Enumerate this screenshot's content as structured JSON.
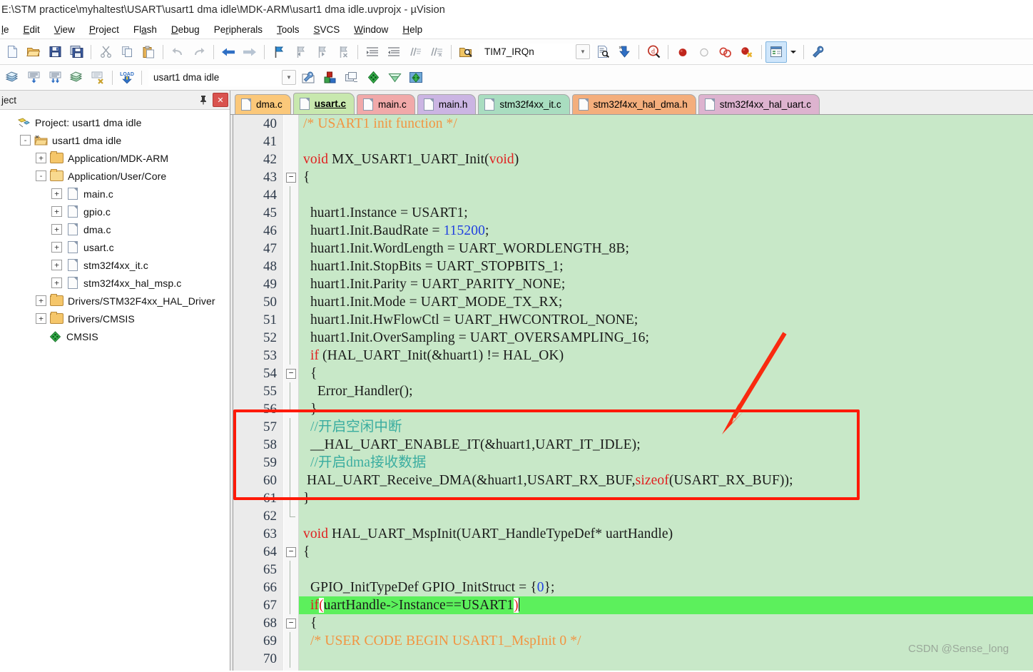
{
  "window": {
    "title": "E:\\STM practice\\myhaltest\\USART\\usart1 dma idle\\MDK-ARM\\usart1 dma idle.uvprojx - µVision"
  },
  "menubar": {
    "items": [
      {
        "label": "File",
        "visible_label": "le"
      },
      {
        "label": "Edit"
      },
      {
        "label": "View"
      },
      {
        "label": "Project"
      },
      {
        "label": "Flash"
      },
      {
        "label": "Debug"
      },
      {
        "label": "Peripherals"
      },
      {
        "label": "Tools"
      },
      {
        "label": "SVCS"
      },
      {
        "label": "Window"
      },
      {
        "label": "Help"
      }
    ]
  },
  "toolbar1": {
    "buttons": [
      {
        "name": "new-file-icon",
        "tip": "New"
      },
      {
        "name": "open-file-icon",
        "tip": "Open"
      },
      {
        "name": "save-icon",
        "tip": "Save"
      },
      {
        "name": "save-all-icon",
        "tip": "Save All"
      },
      {
        "name": "cut-icon",
        "tip": "Cut"
      },
      {
        "name": "copy-icon",
        "tip": "Copy"
      },
      {
        "name": "paste-icon",
        "tip": "Paste"
      },
      {
        "name": "undo-icon",
        "tip": "Undo"
      },
      {
        "name": "redo-icon",
        "tip": "Redo"
      },
      {
        "name": "navigate-back-icon",
        "tip": "Back"
      },
      {
        "name": "navigate-forward-icon",
        "tip": "Forward"
      },
      {
        "name": "bookmark-toggle-icon",
        "tip": "Insert/Remove Bookmark"
      },
      {
        "name": "bookmark-prev-icon",
        "tip": "Previous Bookmark"
      },
      {
        "name": "bookmark-next-icon",
        "tip": "Next Bookmark"
      },
      {
        "name": "bookmark-clear-icon",
        "tip": "Clear All Bookmarks"
      },
      {
        "name": "indent-increase-icon",
        "tip": "Indent"
      },
      {
        "name": "indent-decrease-icon",
        "tip": "Outdent"
      },
      {
        "name": "comment-icon",
        "tip": "Comment"
      },
      {
        "name": "uncomment-icon",
        "tip": "Uncomment"
      }
    ],
    "find_combo": {
      "value": "TIM7_IRQn",
      "placeholder": "Find"
    },
    "right_buttons": [
      {
        "name": "find-in-files-icon",
        "tip": "Find in Files"
      },
      {
        "name": "incremental-find-icon",
        "tip": "Incremental Find"
      },
      {
        "name": "browse-symbol-icon",
        "tip": "Browse Symbol"
      },
      {
        "name": "insert-breakpoint-icon",
        "tip": "Insert/Remove Breakpoint"
      },
      {
        "name": "disable-breakpoint-icon",
        "tip": "Enable/Disable Breakpoint"
      },
      {
        "name": "disable-all-breakpoints-icon",
        "tip": "Disable All Breakpoints"
      },
      {
        "name": "kill-all-breakpoints-icon",
        "tip": "Kill All Breakpoints"
      },
      {
        "name": "project-window-icon",
        "tip": "Project Window"
      },
      {
        "name": "configuration-wizard-icon",
        "tip": "Configure"
      }
    ]
  },
  "toolbar2": {
    "buttons": [
      {
        "name": "translate-icon",
        "tip": "Translate"
      },
      {
        "name": "build-icon",
        "tip": "Build"
      },
      {
        "name": "rebuild-icon",
        "tip": "Rebuild"
      },
      {
        "name": "batch-build-icon",
        "tip": "Batch Build"
      },
      {
        "name": "stop-build-icon",
        "tip": "Stop Build"
      },
      {
        "name": "load-icon",
        "tip": "Download"
      }
    ],
    "target_combo": {
      "value": "usart1 dma idle",
      "placeholder": "Select Target"
    },
    "right_buttons": [
      {
        "name": "target-options-icon",
        "tip": "Options for Target"
      },
      {
        "name": "manage-run-time-icon",
        "tip": "Manage Run-Time Environment"
      },
      {
        "name": "multi-project-icon",
        "tip": "Manage Multi-Project"
      },
      {
        "name": "pack-installer-icon",
        "tip": "Pack Installer"
      },
      {
        "name": "svcs-icon",
        "tip": "Source Control"
      },
      {
        "name": "manage-components-icon",
        "tip": "Manage Components"
      }
    ]
  },
  "project_panel": {
    "title": "ject",
    "pin_icon": "pin-icon",
    "close_icon": "close-icon",
    "tree": [
      {
        "indent": 0,
        "expander": "",
        "icon": "project-icon",
        "label": "Project: usart1 dma idle"
      },
      {
        "indent": 1,
        "expander": "-",
        "icon": "target-folder-icon",
        "label": "usart1 dma idle"
      },
      {
        "indent": 2,
        "expander": "+",
        "icon": "folder-icon",
        "label": "Application/MDK-ARM"
      },
      {
        "indent": 2,
        "expander": "-",
        "icon": "folder-open-icon",
        "label": "Application/User/Core"
      },
      {
        "indent": 3,
        "expander": "+",
        "icon": "file-icon",
        "label": "main.c"
      },
      {
        "indent": 3,
        "expander": "+",
        "icon": "file-icon",
        "label": "gpio.c"
      },
      {
        "indent": 3,
        "expander": "+",
        "icon": "file-icon",
        "label": "dma.c"
      },
      {
        "indent": 3,
        "expander": "+",
        "icon": "file-icon",
        "label": "usart.c"
      },
      {
        "indent": 3,
        "expander": "+",
        "icon": "file-icon",
        "label": "stm32f4xx_it.c"
      },
      {
        "indent": 3,
        "expander": "+",
        "icon": "file-icon",
        "label": "stm32f4xx_hal_msp.c"
      },
      {
        "indent": 2,
        "expander": "+",
        "icon": "folder-icon",
        "label": "Drivers/STM32F4xx_HAL_Driver"
      },
      {
        "indent": 2,
        "expander": "+",
        "icon": "folder-icon",
        "label": "Drivers/CMSIS"
      },
      {
        "indent": 2,
        "expander": "",
        "icon": "cmsis-icon",
        "label": "CMSIS"
      }
    ]
  },
  "editor": {
    "tabs": [
      {
        "label": "dma.c",
        "color": "#fbc87a",
        "active": false
      },
      {
        "label": "usart.c",
        "color": "#c8e8ae",
        "active": true
      },
      {
        "label": "main.c",
        "color": "#f1a9a9",
        "active": false
      },
      {
        "label": "main.h",
        "color": "#cbb5e3",
        "active": false
      },
      {
        "label": "stm32f4xx_it.c",
        "color": "#a9ddc0",
        "active": false
      },
      {
        "label": "stm32f4xx_hal_dma.h",
        "color": "#f4ae7c",
        "active": false
      },
      {
        "label": "stm32f4xx_hal_uart.c",
        "color": "#ddb3cf",
        "active": false
      }
    ],
    "first_line_number": 40,
    "lines": [
      {
        "n": 40,
        "fold": "",
        "tokens": [
          {
            "t": "/* USART1 init function */",
            "c": "cmt"
          }
        ]
      },
      {
        "n": 41,
        "fold": "",
        "tokens": []
      },
      {
        "n": 42,
        "fold": "",
        "tokens": [
          {
            "t": "void",
            "c": "kw"
          },
          {
            "t": " MX_USART1_UART_Init(",
            "c": ""
          },
          {
            "t": "void",
            "c": "kw"
          },
          {
            "t": ")",
            "c": ""
          }
        ]
      },
      {
        "n": 43,
        "fold": "start",
        "tokens": [
          {
            "t": "{",
            "c": ""
          }
        ]
      },
      {
        "n": 44,
        "fold": "bar",
        "tokens": []
      },
      {
        "n": 45,
        "fold": "bar",
        "tokens": [
          {
            "t": "  huart1.Instance = USART1;",
            "c": ""
          }
        ]
      },
      {
        "n": 46,
        "fold": "bar",
        "tokens": [
          {
            "t": "  huart1.Init.BaudRate = ",
            "c": ""
          },
          {
            "t": "115200",
            "c": "num"
          },
          {
            "t": ";",
            "c": ""
          }
        ]
      },
      {
        "n": 47,
        "fold": "bar",
        "tokens": [
          {
            "t": "  huart1.Init.WordLength = UART_WORDLENGTH_8B;",
            "c": ""
          }
        ]
      },
      {
        "n": 48,
        "fold": "bar",
        "tokens": [
          {
            "t": "  huart1.Init.StopBits = UART_STOPBITS_1;",
            "c": ""
          }
        ]
      },
      {
        "n": 49,
        "fold": "bar",
        "tokens": [
          {
            "t": "  huart1.Init.Parity = UART_PARITY_NONE;",
            "c": ""
          }
        ]
      },
      {
        "n": 50,
        "fold": "bar",
        "tokens": [
          {
            "t": "  huart1.Init.Mode = UART_MODE_TX_RX;",
            "c": ""
          }
        ]
      },
      {
        "n": 51,
        "fold": "bar",
        "tokens": [
          {
            "t": "  huart1.Init.HwFlowCtl = UART_HWCONTROL_NONE;",
            "c": ""
          }
        ]
      },
      {
        "n": 52,
        "fold": "bar",
        "tokens": [
          {
            "t": "  huart1.Init.OverSampling = UART_OVERSAMPLING_16;",
            "c": ""
          }
        ]
      },
      {
        "n": 53,
        "fold": "bar",
        "tokens": [
          {
            "t": "  ",
            "c": ""
          },
          {
            "t": "if",
            "c": "kw"
          },
          {
            "t": " (HAL_UART_Init(&huart1) != HAL_OK)",
            "c": ""
          }
        ]
      },
      {
        "n": 54,
        "fold": "start",
        "tokens": [
          {
            "t": "  {",
            "c": ""
          }
        ]
      },
      {
        "n": 55,
        "fold": "bar",
        "tokens": [
          {
            "t": "    Error_Handler();",
            "c": ""
          }
        ]
      },
      {
        "n": 56,
        "fold": "end",
        "tokens": [
          {
            "t": "  }",
            "c": ""
          }
        ]
      },
      {
        "n": 57,
        "fold": "bar",
        "tokens": [
          {
            "t": "  //开启空闲中断",
            "c": "cmt2"
          }
        ]
      },
      {
        "n": 58,
        "fold": "bar",
        "tokens": [
          {
            "t": "  __HAL_UART_ENABLE_IT(&huart1,UART_IT_IDLE);",
            "c": ""
          }
        ]
      },
      {
        "n": 59,
        "fold": "bar",
        "tokens": [
          {
            "t": "  //开启dma接收数据",
            "c": "cmt2"
          }
        ]
      },
      {
        "n": 60,
        "fold": "bar",
        "tokens": [
          {
            "t": " HAL_UART_Receive_DMA(&huart1,USART_RX_BUF,",
            "c": ""
          },
          {
            "t": "sizeof",
            "c": "kw"
          },
          {
            "t": "(USART_RX_BUF));",
            "c": ""
          }
        ]
      },
      {
        "n": 61,
        "fold": "bar",
        "tokens": [
          {
            "t": "}",
            "c": ""
          }
        ]
      },
      {
        "n": 62,
        "fold": "end",
        "tokens": []
      },
      {
        "n": 63,
        "fold": "",
        "tokens": [
          {
            "t": "void",
            "c": "kw"
          },
          {
            "t": " HAL_UART_MspInit(UART_HandleTypeDef* uartHandle)",
            "c": ""
          }
        ]
      },
      {
        "n": 64,
        "fold": "start",
        "tokens": [
          {
            "t": "{",
            "c": ""
          }
        ]
      },
      {
        "n": 65,
        "fold": "bar",
        "tokens": []
      },
      {
        "n": 66,
        "fold": "bar",
        "tokens": [
          {
            "t": "  GPIO_InitTypeDef GPIO_InitStruct = {",
            "c": ""
          },
          {
            "t": "0",
            "c": "num"
          },
          {
            "t": "};",
            "c": ""
          }
        ]
      },
      {
        "n": 67,
        "fold": "bar",
        "highlight": true,
        "cursor": true,
        "tokens": [
          {
            "t": "  ",
            "c": ""
          },
          {
            "t": "if",
            "c": "kw"
          },
          {
            "t": "(uartHandle->Instance==USART1",
            "c": ""
          },
          {
            "t": ")",
            "c": ""
          }
        ]
      },
      {
        "n": 68,
        "fold": "start",
        "tokens": [
          {
            "t": "  {",
            "c": ""
          }
        ]
      },
      {
        "n": 69,
        "fold": "bar",
        "tokens": [
          {
            "t": "  /* USER CODE BEGIN USART1_MspInit 0 */",
            "c": "cmt"
          }
        ]
      },
      {
        "n": 70,
        "fold": "bar",
        "tokens": []
      }
    ]
  },
  "annotations": {
    "red_box": {
      "label": "red-highlight-box",
      "color": "#ff1a08"
    },
    "red_arrow": {
      "label": "red-pointer-arrow",
      "color": "#f92a10"
    },
    "watermark": "CSDN @Sense_long"
  }
}
